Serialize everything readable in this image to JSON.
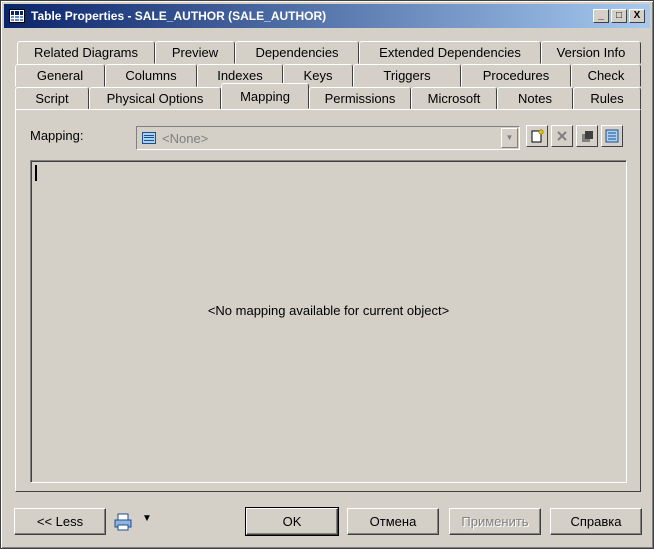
{
  "window": {
    "title": "Table Properties - SALE_AUTHOR (SALE_AUTHOR)",
    "controls": {
      "minimize": "_",
      "maximize": "□",
      "close": "X"
    }
  },
  "tabs": {
    "row1": [
      "Related Diagrams",
      "Preview",
      "Dependencies",
      "Extended Dependencies",
      "Version Info"
    ],
    "row2": [
      "General",
      "Columns",
      "Indexes",
      "Keys",
      "Triggers",
      "Procedures",
      "Check"
    ],
    "row3": [
      "Script",
      "Physical Options",
      "Mapping",
      "Permissions",
      "Microsoft",
      "Notes",
      "Rules"
    ],
    "active": "Mapping"
  },
  "mapping": {
    "label": "Mapping:",
    "combo_value": "<None>",
    "empty_message": "<No mapping available for current object>"
  },
  "icons": {
    "combo": "list-icon",
    "new": "new-document-icon",
    "delete": "delete-icon",
    "properties": "properties-icon",
    "list": "list-view-icon",
    "print": "print-icon"
  },
  "buttons": {
    "less": "<< Less",
    "ok": "OK",
    "cancel": "Отмена",
    "apply": "Применить",
    "help": "Справка"
  },
  "colors": {
    "face": "#d4d0c8",
    "title_start": "#0a246a",
    "title_end": "#a6caf0"
  }
}
